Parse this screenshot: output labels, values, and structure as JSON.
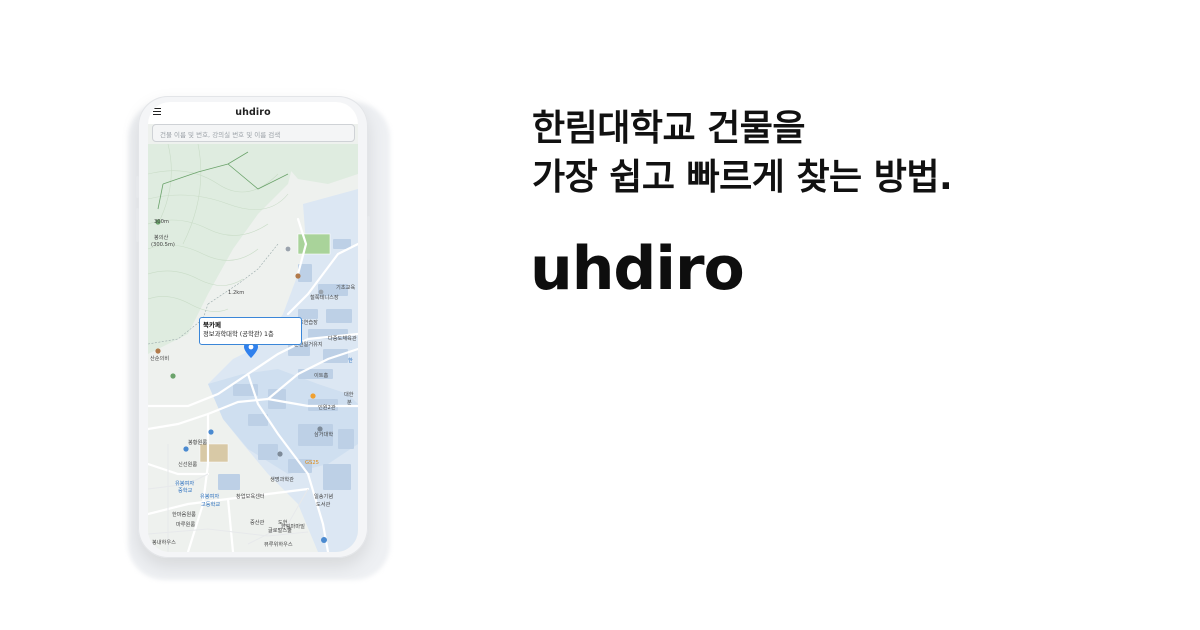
{
  "app": {
    "title": "uhdiro",
    "search_placeholder": "건물 이름 및 번호, 강의실 번호 및 이름 검색"
  },
  "callout": {
    "name": "북카페",
    "location": "정보과학대학 (공학관) 1층"
  },
  "map": {
    "labels": [
      "철쭉테니스장",
      "기초교육",
      "골프연습장",
      "춘천일거유지",
      "다중도체육관",
      "한",
      "이트홈",
      "인원2관",
      "대한",
      "분",
      "삼거대학",
      "GS25",
      "생명과학관",
      "창업보육센터",
      "일송기념",
      "도서관",
      "중산관",
      "도헌",
      "글로벌스쿨",
      "봉황원룸",
      "신선원룸",
      "유봉여자",
      "중학교",
      "유봉여자",
      "고등학교",
      "한마음원룸",
      "마루원룸",
      "봉내하우스",
      "한림마마빌",
      "뷰루위하우스",
      "봉의산",
      "(300.5m)",
      "300m",
      "1.2km",
      "산순의비"
    ],
    "colors": {
      "land": "#eef1ee",
      "green": "#dbe9d6",
      "campus": "#d7e4f2",
      "building": "#c4d5e8",
      "road": "#ffffff",
      "pin": "#2f80ed"
    }
  },
  "marketing": {
    "headline_line1": "한림대학교 건물을",
    "headline_line2": "가장 쉽고 빠르게 찾는 방법.",
    "brand": "uhdiro"
  }
}
